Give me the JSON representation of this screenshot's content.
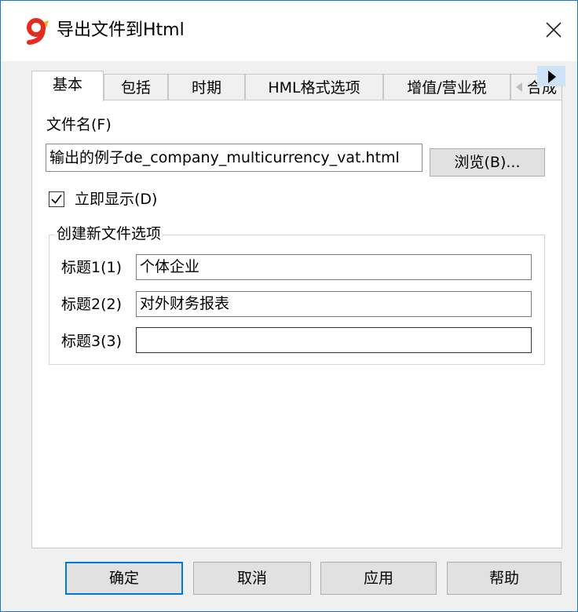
{
  "window": {
    "title": "导出文件到Html",
    "app_icon": "app-logo-icon",
    "close_icon": "close-icon"
  },
  "tabs": [
    {
      "label": "基本",
      "active": true
    },
    {
      "label": "包括",
      "active": false
    },
    {
      "label": "时期",
      "active": false
    },
    {
      "label": "HML格式选项",
      "active": false
    },
    {
      "label": "增值/营业税",
      "active": false
    },
    {
      "label": "合成",
      "active": false
    }
  ],
  "file": {
    "label": "文件名(F)",
    "value": "输出的例子de_company_multicurrency_vat.html",
    "browse_label": "浏览(B)..."
  },
  "show_immediately": {
    "label": "立即显示(D)",
    "checked": true
  },
  "new_file_options": {
    "group_title": "创建新文件选项",
    "rows": [
      {
        "label": "标题1(1)",
        "value": "个体企业"
      },
      {
        "label": "标题2(2)",
        "value": "对外财务报表"
      },
      {
        "label": "标题3(3)",
        "value": ""
      }
    ]
  },
  "buttons": {
    "ok": "确定",
    "cancel": "取消",
    "apply": "应用",
    "help": "帮助"
  },
  "colors": {
    "logo_red": "#e32b1f",
    "logo_yellow": "#f3b21b",
    "accent": "#0078d7",
    "window_border": "#1a74d0"
  }
}
